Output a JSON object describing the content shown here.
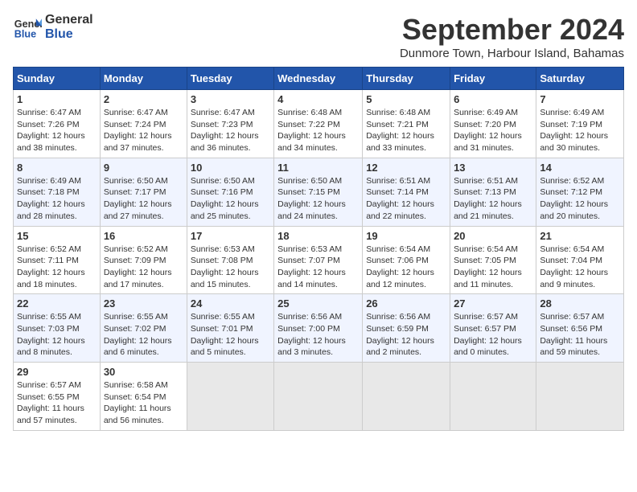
{
  "header": {
    "logo_line1": "General",
    "logo_line2": "Blue",
    "month_title": "September 2024",
    "location": "Dunmore Town, Harbour Island, Bahamas"
  },
  "weekdays": [
    "Sunday",
    "Monday",
    "Tuesday",
    "Wednesday",
    "Thursday",
    "Friday",
    "Saturday"
  ],
  "weeks": [
    [
      {
        "day": "1",
        "sunrise": "6:47 AM",
        "sunset": "7:26 PM",
        "daylight": "12 hours and 38 minutes."
      },
      {
        "day": "2",
        "sunrise": "6:47 AM",
        "sunset": "7:24 PM",
        "daylight": "12 hours and 37 minutes."
      },
      {
        "day": "3",
        "sunrise": "6:47 AM",
        "sunset": "7:23 PM",
        "daylight": "12 hours and 36 minutes."
      },
      {
        "day": "4",
        "sunrise": "6:48 AM",
        "sunset": "7:22 PM",
        "daylight": "12 hours and 34 minutes."
      },
      {
        "day": "5",
        "sunrise": "6:48 AM",
        "sunset": "7:21 PM",
        "daylight": "12 hours and 33 minutes."
      },
      {
        "day": "6",
        "sunrise": "6:49 AM",
        "sunset": "7:20 PM",
        "daylight": "12 hours and 31 minutes."
      },
      {
        "day": "7",
        "sunrise": "6:49 AM",
        "sunset": "7:19 PM",
        "daylight": "12 hours and 30 minutes."
      }
    ],
    [
      {
        "day": "8",
        "sunrise": "6:49 AM",
        "sunset": "7:18 PM",
        "daylight": "12 hours and 28 minutes."
      },
      {
        "day": "9",
        "sunrise": "6:50 AM",
        "sunset": "7:17 PM",
        "daylight": "12 hours and 27 minutes."
      },
      {
        "day": "10",
        "sunrise": "6:50 AM",
        "sunset": "7:16 PM",
        "daylight": "12 hours and 25 minutes."
      },
      {
        "day": "11",
        "sunrise": "6:50 AM",
        "sunset": "7:15 PM",
        "daylight": "12 hours and 24 minutes."
      },
      {
        "day": "12",
        "sunrise": "6:51 AM",
        "sunset": "7:14 PM",
        "daylight": "12 hours and 22 minutes."
      },
      {
        "day": "13",
        "sunrise": "6:51 AM",
        "sunset": "7:13 PM",
        "daylight": "12 hours and 21 minutes."
      },
      {
        "day": "14",
        "sunrise": "6:52 AM",
        "sunset": "7:12 PM",
        "daylight": "12 hours and 20 minutes."
      }
    ],
    [
      {
        "day": "15",
        "sunrise": "6:52 AM",
        "sunset": "7:11 PM",
        "daylight": "12 hours and 18 minutes."
      },
      {
        "day": "16",
        "sunrise": "6:52 AM",
        "sunset": "7:09 PM",
        "daylight": "12 hours and 17 minutes."
      },
      {
        "day": "17",
        "sunrise": "6:53 AM",
        "sunset": "7:08 PM",
        "daylight": "12 hours and 15 minutes."
      },
      {
        "day": "18",
        "sunrise": "6:53 AM",
        "sunset": "7:07 PM",
        "daylight": "12 hours and 14 minutes."
      },
      {
        "day": "19",
        "sunrise": "6:54 AM",
        "sunset": "7:06 PM",
        "daylight": "12 hours and 12 minutes."
      },
      {
        "day": "20",
        "sunrise": "6:54 AM",
        "sunset": "7:05 PM",
        "daylight": "12 hours and 11 minutes."
      },
      {
        "day": "21",
        "sunrise": "6:54 AM",
        "sunset": "7:04 PM",
        "daylight": "12 hours and 9 minutes."
      }
    ],
    [
      {
        "day": "22",
        "sunrise": "6:55 AM",
        "sunset": "7:03 PM",
        "daylight": "12 hours and 8 minutes."
      },
      {
        "day": "23",
        "sunrise": "6:55 AM",
        "sunset": "7:02 PM",
        "daylight": "12 hours and 6 minutes."
      },
      {
        "day": "24",
        "sunrise": "6:55 AM",
        "sunset": "7:01 PM",
        "daylight": "12 hours and 5 minutes."
      },
      {
        "day": "25",
        "sunrise": "6:56 AM",
        "sunset": "7:00 PM",
        "daylight": "12 hours and 3 minutes."
      },
      {
        "day": "26",
        "sunrise": "6:56 AM",
        "sunset": "6:59 PM",
        "daylight": "12 hours and 2 minutes."
      },
      {
        "day": "27",
        "sunrise": "6:57 AM",
        "sunset": "6:57 PM",
        "daylight": "12 hours and 0 minutes."
      },
      {
        "day": "28",
        "sunrise": "6:57 AM",
        "sunset": "6:56 PM",
        "daylight": "11 hours and 59 minutes."
      }
    ],
    [
      {
        "day": "29",
        "sunrise": "6:57 AM",
        "sunset": "6:55 PM",
        "daylight": "11 hours and 57 minutes."
      },
      {
        "day": "30",
        "sunrise": "6:58 AM",
        "sunset": "6:54 PM",
        "daylight": "11 hours and 56 minutes."
      },
      null,
      null,
      null,
      null,
      null
    ]
  ]
}
